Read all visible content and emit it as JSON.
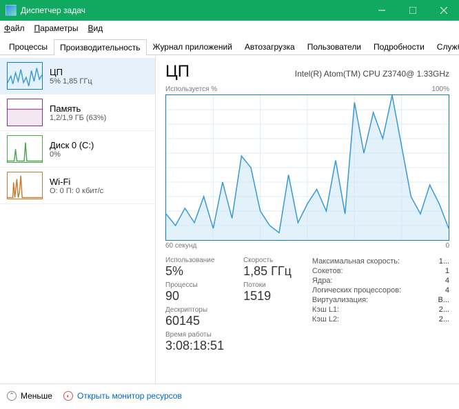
{
  "window": {
    "title": "Диспетчер задач"
  },
  "menu": {
    "file": "Файл",
    "options": "Параметры",
    "view": "Вид"
  },
  "tabs": {
    "t0": "Процессы",
    "t1": "Производительность",
    "t2": "Журнал приложений",
    "t3": "Автозагрузка",
    "t4": "Пользователи",
    "t5": "Подробности",
    "t6": "Службы"
  },
  "sidebar": {
    "cpu": {
      "title": "ЦП",
      "sub": "5%  1,85 ГГц"
    },
    "mem": {
      "title": "Память",
      "sub": "1,2/1,9 ГБ (63%)"
    },
    "disk": {
      "title": "Диск 0 (C:)",
      "sub": "0%"
    },
    "wifi": {
      "title": "Wi-Fi",
      "sub": "О: 0 П: 0 кбит/с"
    }
  },
  "header": {
    "title": "ЦП",
    "sub": "Intel(R) Atom(TM) CPU Z3740@ 1.33GHz"
  },
  "chartTop": {
    "left": "Используется %",
    "right": "100%"
  },
  "chartBottom": {
    "left": "60 секунд",
    "right": "0"
  },
  "stats": {
    "usage_lbl": "Использование",
    "usage_val": "5%",
    "speed_lbl": "Скорость",
    "speed_val": "1,85 ГГц",
    "proc_lbl": "Процессы",
    "proc_val": "90",
    "thread_lbl": "Потоки",
    "thread_val": "1519",
    "handle_lbl": "Дескрипторы",
    "handle_val": "60145",
    "uptime_lbl": "Время работы",
    "uptime_val": "3:08:18:51"
  },
  "details": {
    "maxspeed_lbl": "Максимальная скорость:",
    "maxspeed_val": "1...",
    "sockets_lbl": "Сокетов:",
    "sockets_val": "1",
    "cores_lbl": "Ядра:",
    "cores_val": "4",
    "logical_lbl": "Логических процессоров:",
    "logical_val": "4",
    "virt_lbl": "Виртуализация:",
    "virt_val": "В...",
    "l1_lbl": "Кэш L1:",
    "l1_val": "2...",
    "l2_lbl": "Кэш L2:",
    "l2_val": "2..."
  },
  "status": {
    "fewer": "Меньше",
    "monitor": "Открыть монитор ресурсов"
  },
  "chart_data": {
    "type": "area",
    "title": "Используется %",
    "xlabel": "60 секунд",
    "ylabel": "%",
    "ylim": [
      0,
      100
    ],
    "x_seconds_ago": [
      60,
      58,
      56,
      54,
      52,
      50,
      48,
      46,
      44,
      42,
      40,
      38,
      36,
      34,
      32,
      30,
      28,
      26,
      24,
      22,
      20,
      18,
      16,
      14,
      12,
      10,
      8,
      6,
      4,
      2,
      0
    ],
    "values": [
      18,
      10,
      22,
      12,
      30,
      8,
      40,
      15,
      58,
      50,
      20,
      10,
      5,
      45,
      12,
      25,
      35,
      20,
      55,
      18,
      95,
      60,
      88,
      70,
      100,
      65,
      30,
      18,
      38,
      25,
      8
    ]
  }
}
